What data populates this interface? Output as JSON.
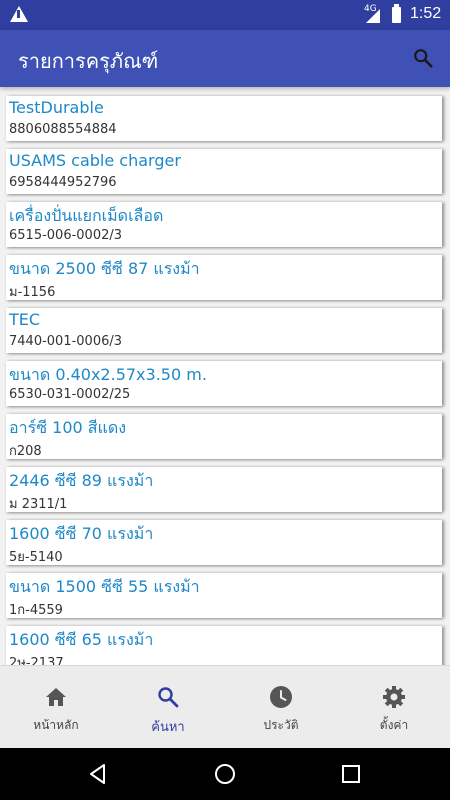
{
  "status_bar": {
    "network": "4G",
    "time": "1:52"
  },
  "app_bar": {
    "title": "รายการครุภัณฑ์",
    "action_icon": "search-icon"
  },
  "items": [
    {
      "name": "TestDurable",
      "code": "8806088554884"
    },
    {
      "name": "USAMS cable charger",
      "code": "6958444952796"
    },
    {
      "name": "เครื่องปั่นแยกเม็ดเลือด",
      "code": "6515-006-0002/3"
    },
    {
      "name": "ขนาด 2500 ซีซี 87 แรงม้า",
      "code": "ม-1156"
    },
    {
      "name": "TEC",
      "code": "7440-001-0006/3"
    },
    {
      "name": "ขนาด 0.40x2.57x3.50 m.",
      "code": "6530-031-0002/25"
    },
    {
      "name": "อาร์ซี 100 สีแดง",
      "code": "ก208"
    },
    {
      "name": "2446 ซีซี 89 แรงม้า",
      "code": "ม 2311/1"
    },
    {
      "name": "1600 ซีซี 70 แรงม้า",
      "code": "5ย-5140"
    },
    {
      "name": "ขนาด 1500 ซีซี 55 แรงม้า",
      "code": "1ก-4559"
    },
    {
      "name": "1600 ซีซี 65 แรงม้า",
      "code": "2ษ-2137"
    }
  ],
  "bottom_nav": [
    {
      "label": "หน้าหลัก",
      "icon": "home-icon",
      "active": false
    },
    {
      "label": "ค้นหา",
      "icon": "search-icon",
      "active": true
    },
    {
      "label": "ประวัติ",
      "icon": "history-icon",
      "active": false
    },
    {
      "label": "ตั้งค่า",
      "icon": "settings-icon",
      "active": false
    }
  ],
  "colors": {
    "primary": "#3f51b5",
    "primary_dark": "#303f9f",
    "item_title": "#1e88c8",
    "accent_nav": "#303f9f"
  }
}
